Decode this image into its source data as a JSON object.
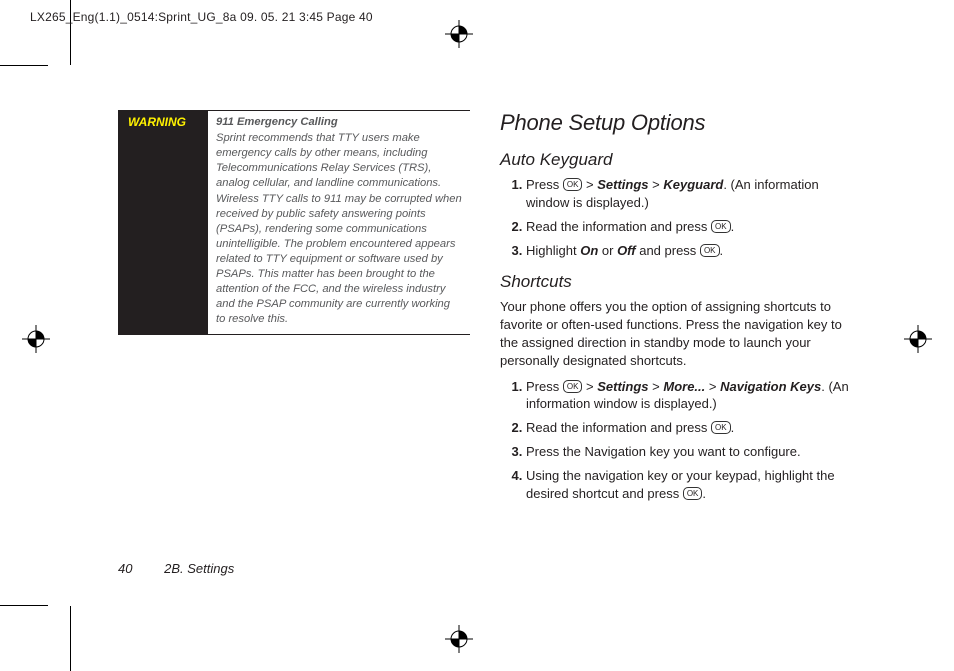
{
  "header": {
    "imposition_line": "LX265_Eng(1.1)_0514:Sprint_UG_8a  09. 05. 21    3:45  Page 40"
  },
  "left_col": {
    "warning_label": "WARNING",
    "warning_title": "911 Emergency Calling",
    "warning_body": "Sprint recommends that TTY users make emergency calls by other means, including Telecommunications Relay Services (TRS), analog cellular, and landline communications. Wireless TTY calls to 911 may be corrupted when received by public safety answering points (PSAPs), rendering some communications unintelligible. The problem encountered appears related to TTY equipment or software used by PSAPs. This matter has been brought to the attention of the FCC, and the wireless industry and the PSAP community are currently working to resolve this."
  },
  "right_col": {
    "h1": "Phone Setup Options",
    "auto_keyguard": {
      "heading": "Auto Keyguard",
      "step1_a": "Press ",
      "step1_b": " > ",
      "step1_settings": "Settings",
      "step1_c": " > ",
      "step1_keyguard": "Keyguard",
      "step1_d": ". (An information window is displayed.)",
      "step2_a": "Read the information and press ",
      "step2_b": ".",
      "step3_a": "Highlight ",
      "step3_on": "On",
      "step3_b": " or ",
      "step3_off": "Off",
      "step3_c": " and press ",
      "step3_d": "."
    },
    "shortcuts": {
      "heading": "Shortcuts",
      "intro": "Your phone offers you the option of assigning shortcuts to favorite or often-used functions. Press the navigation key to the assigned direction in standby mode to launch your personally designated shortcuts.",
      "step1_a": "Press ",
      "step1_b": " > ",
      "step1_settings": "Settings",
      "step1_c": " > ",
      "step1_more": "More...",
      "step1_d": " > ",
      "step1_nav": "Navigation Keys",
      "step1_e": ". (An information window is displayed.)",
      "step2_a": "Read the information and press ",
      "step2_b": ".",
      "step3": "Press the Navigation key you want to configure.",
      "step4_a": "Using the navigation key or your keypad, highlight the desired shortcut and press ",
      "step4_b": "."
    }
  },
  "footer": {
    "page_number": "40",
    "section": "2B. Settings"
  },
  "icons": {
    "ok_button_label": "OK"
  }
}
